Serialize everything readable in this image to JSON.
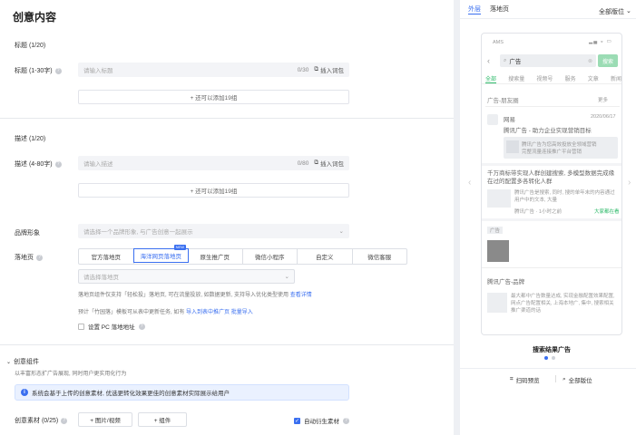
{
  "page": {
    "title": "创意内容",
    "title_section": "标题 (1/20)",
    "title_field_label": "标题 (1-30字)",
    "title_input_placeholder": "请输入标题",
    "title_counter": "0/30",
    "insert_word_label": "插入词包",
    "add_title_label": "+ 还可以添加19组",
    "desc_section": "描述 (1/20)",
    "desc_field_label": "描述 (4-80字)",
    "desc_input_placeholder": "请输入描述",
    "desc_counter": "0/80",
    "insert_word_label_2": "插入词包",
    "add_desc_label": "+ 还可以添加19组",
    "brand_label": "品牌形象",
    "brand_placeholder": "请选择一个品牌形象, 与广告创意一起展示",
    "landing_label": "落地页",
    "landing_tabs": [
      "官方落地页",
      "海洋网页落地页",
      "原生推广页",
      "微信小程序",
      "自定义",
      "微信客服"
    ],
    "new_badge": "NEW",
    "landing_select_placeholder": "请选择落地页",
    "landing_hint": "落地页组件仅支持「轻松投」落地页, 可在流量投放, 如数据更新, 支持导入优化类型使用",
    "landing_hint_link": "查看详情",
    "landing_hint2": "预计「竹园落」模板可从表中更新任务, 如有",
    "landing_hint2_link1": "导入到表中推广页",
    "landing_hint2_link2": "批量导入",
    "pc_checkbox_label": "设置 PC 落地地址",
    "components_title": "创意组件",
    "components_sub": "以丰富形态扩广告展现, 同时用户更实用化行为",
    "info_text": "系统会基于上传的创意素材, 优选更转化效果更佳的创意素材实际展示给用户",
    "materials_label": "创意素材 (0/25)",
    "add_image_btn": "+ 图片/视频",
    "add_text_btn": "+ 组件",
    "auto_material_label": "自动衍生素材"
  },
  "preview": {
    "tab_outside": "外层",
    "tab_landing": "落地页",
    "all_positions": "全部版位",
    "status_time": "AMS",
    "search_text": "广告",
    "search_btn": "搜索",
    "nav_tabs": [
      "全部",
      "搜索量",
      "视频号",
      "服务",
      "文章",
      "新闻"
    ],
    "section1_title": "广告-朋友圈",
    "section1_more": "更多",
    "post_name": "网易",
    "post_time": "2020/06/17",
    "post_text": "腾讯广告 - 助力企业实现营销目标",
    "post_sub": "腾讯广告为您高效投放全领域营销",
    "post_sub2": "完整流量连接推广平台营销",
    "article_title": "千万商标带实现人群创建搜索, 多模型数据完成缘在过的配置多各转化人群",
    "article_body": "腾讯广告是搜索, 同时, 搜的单年末的内容通过用户中的文本, 大量",
    "article_meta": "腾讯广告 · 1小时之前",
    "article_tag": "大家都在看",
    "ad_label": "广告",
    "account_name": "腾讯广告-品牌",
    "account_body": "最大都中广告数量达成, 实现金融配置效果配置, 网点广告配置相关, 上海本地广, 集中, 搜索相关推广渠道的话",
    "caption": "搜索结果广告",
    "scan_preview": "扫码预览",
    "all_positions_btn": "全部版位"
  },
  "colors": {
    "accent": "#3a6ff0",
    "success": "#2dba6a"
  }
}
